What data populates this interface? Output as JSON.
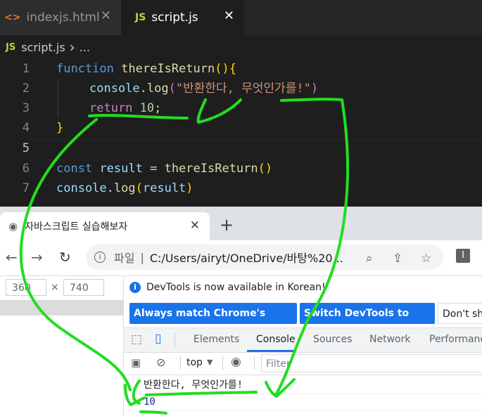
{
  "editor": {
    "tabs": [
      {
        "icon": "<>",
        "label": "indexjs.html"
      },
      {
        "icon": "JS",
        "label": "script.js"
      }
    ],
    "close_glyph": "✕",
    "breadcrumb": {
      "icon": "JS",
      "file": "script.js",
      "sep": "›",
      "rest": "..."
    },
    "line_numbers": [
      "1",
      "2",
      "3",
      "4",
      "5",
      "6",
      "7"
    ],
    "code": {
      "l1": {
        "kw": "function",
        "fn": "thereIsReturn",
        "paren": "()",
        "brace": "{"
      },
      "l2": {
        "obj": "console",
        "dot": ".",
        "fn": "log",
        "open": "(",
        "str": "\"반환한다, 무엇인가를!\"",
        "close": ")"
      },
      "l3": {
        "kw": "return",
        "num": "10",
        "semi": ";"
      },
      "l4": {
        "brace": "}"
      },
      "l6": {
        "kw": "const",
        "var": "result",
        "eq": " = ",
        "fn": "thereIsReturn",
        "paren": "()"
      },
      "l7": {
        "obj": "console",
        "dot": ".",
        "fn": "log",
        "open": "(",
        "var": "result",
        "close": ")"
      }
    }
  },
  "browser": {
    "tab_title": "자바스크립트 실습해보자",
    "tab_close": "✕",
    "new_tab": "+",
    "protocol": "파일",
    "address_sep": "|",
    "address": "C:/Users/airyt/OneDrive/바탕%20...",
    "info_glyph": "i",
    "extension_glyph": "I",
    "device": {
      "width": "360",
      "times": "×",
      "height": "740"
    },
    "devtools": {
      "notice": "DevTools is now available in Korean!",
      "notice_icon": "i",
      "buttons": [
        "Always match Chrome's language",
        "Switch DevTools to Korean",
        "Don't sh"
      ],
      "tabs": [
        "Elements",
        "Console",
        "Sources",
        "Network",
        "Performanc"
      ],
      "active_tab": "Console",
      "context": "top",
      "context_arrow": "▼",
      "filter_placeholder": "Filter",
      "logs": [
        {
          "text": "반환한다, 무엇인가를!"
        },
        {
          "text": "10",
          "color": "#1a1aa6"
        }
      ]
    }
  },
  "annotation": {
    "color": "#22dd22"
  }
}
